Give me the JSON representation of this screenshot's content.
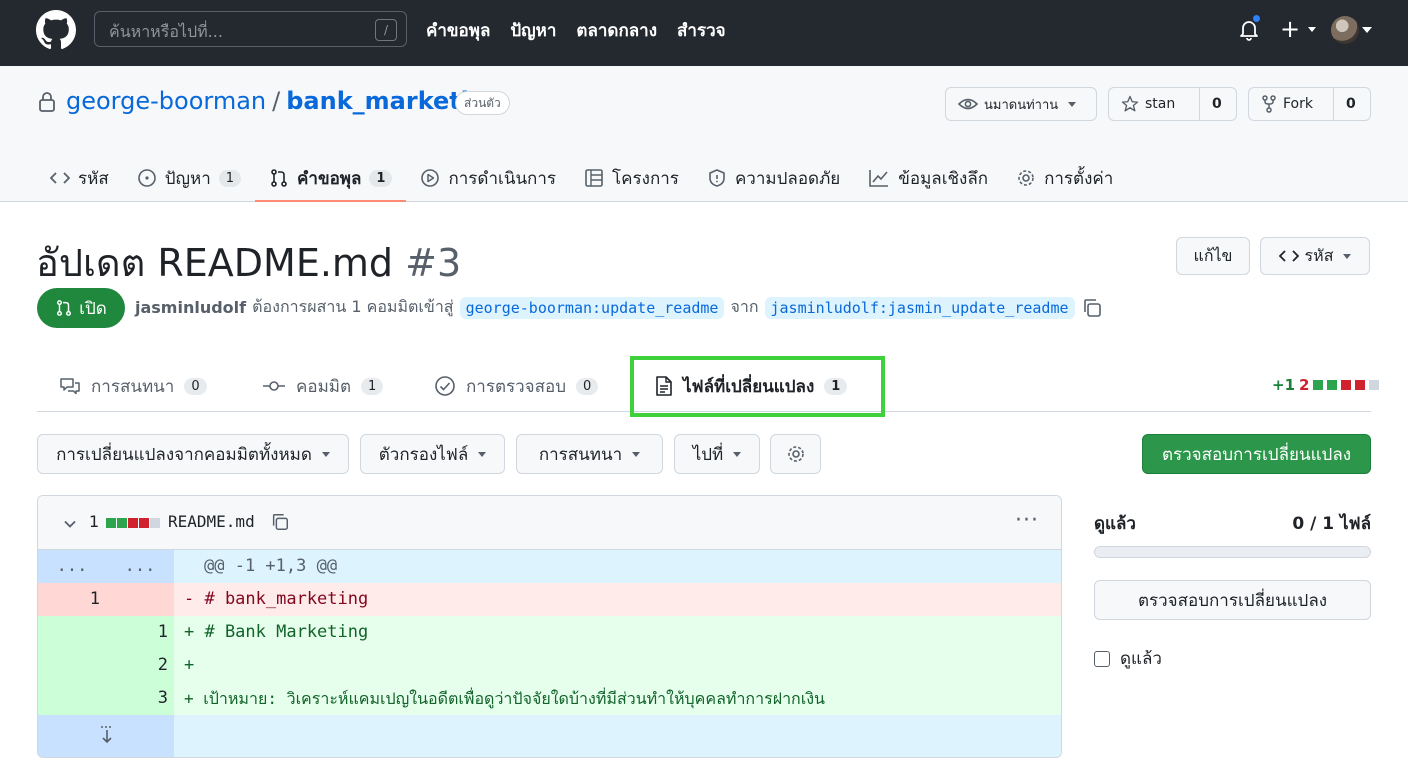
{
  "header": {
    "search_placeholder": "ค้นหาหรือไปที่...",
    "search_shortcut": "/",
    "nav": [
      "คำขอพุล",
      "ปัญหา",
      "ตลาดกลาง",
      "สำรวจ"
    ],
    "plus": "+",
    "icons": [
      "github-logo",
      "bell-icon",
      "plus-icon",
      "avatar"
    ]
  },
  "repo": {
    "owner": "george-boorman",
    "separator": "/",
    "name": "bank_marketing",
    "visibility": "ส่วนตัว",
    "watch_label": "นมาดนท่าาน",
    "star_label": "stan",
    "star_count": "0",
    "fork_label": "Fork",
    "fork_count": "0",
    "tabs": [
      {
        "label": "รหัส",
        "count": "",
        "icon": "code-icon"
      },
      {
        "label": "ปัญหา",
        "count": "1",
        "icon": "issue-icon"
      },
      {
        "label": "คำขอพุล",
        "count": "1",
        "icon": "pull-request-icon",
        "active": true
      },
      {
        "label": "การดำเนินการ",
        "count": "",
        "icon": "play-icon"
      },
      {
        "label": "โครงการ",
        "count": "",
        "icon": "table-icon"
      },
      {
        "label": "ความปลอดภัย",
        "count": "",
        "icon": "shield-icon"
      },
      {
        "label": "ข้อมูลเชิงลึก",
        "count": "",
        "icon": "graph-icon"
      },
      {
        "label": "การตั้งค่า",
        "count": "",
        "icon": "gear-icon"
      }
    ]
  },
  "pr": {
    "title": "อัปเดต README.md",
    "number": "#3",
    "edit_label": "แก้ไข",
    "code_label": "รหัส",
    "state": "เปิด",
    "author": "jasminludolf",
    "action_text": "ต้องการผสาน 1 คอมมิตเข้าสู่",
    "base_branch": "george-boorman:update_readme",
    "from_text": "จาก",
    "head_branch": "jasminludolf:jasmin_update_readme",
    "tabs": [
      {
        "label": "การสนทนา",
        "count": "0",
        "icon": "comment-icon"
      },
      {
        "label": "คอมมิต",
        "count": "1",
        "icon": "commit-icon"
      },
      {
        "label": "การตรวจสอบ",
        "count": "0",
        "icon": "check-circle-icon"
      },
      {
        "label": "ไฟล์ที่เปลี่ยนแปลง",
        "count": "1",
        "icon": "file-icon",
        "active": true
      }
    ],
    "diffstat_add": "+1",
    "diffstat_del": "2"
  },
  "toolbar": {
    "commits_filter": "การเปลี่ยนแปลงจากคอมมิตทั้งหมด",
    "file_filter": "ตัวกรองไฟล์",
    "conversations": "การสนทนา",
    "jump": "ไปที่",
    "review_button": "ตรวจสอบการเปลี่ยนแปลง"
  },
  "file": {
    "change_count": "1",
    "name": "README.md",
    "lines": [
      {
        "type": "hunk",
        "old": "...",
        "new": "...",
        "text": "@@ -1 +1,3 @@"
      },
      {
        "type": "del",
        "old": "1",
        "new": "",
        "text": "- # bank_marketing"
      },
      {
        "type": "add",
        "old": "",
        "new": "1",
        "text": "+ # Bank Marketing"
      },
      {
        "type": "add",
        "old": "",
        "new": "2",
        "text": "+"
      },
      {
        "type": "add",
        "old": "",
        "new": "3",
        "text": "+ เป้าหมาย: วิเคราะห์แคมเปญในอดีตเพื่อดูว่าปัจจัยใดบ้างที่มีส่วนทำให้บุคคลทำการฝากเงิน"
      },
      {
        "type": "expand",
        "old": "",
        "new": "",
        "text": ""
      }
    ]
  },
  "sidebar": {
    "viewed_title": "ดูแล้ว",
    "viewed_count": "0 / 1 ไฟล์",
    "viewed_progress": 0,
    "review_button": "ตรวจสอบการเปลี่ยนแปลง",
    "viewed_checkbox": "ดูแล้ว"
  },
  "colors": {
    "header_bg": "#24292f",
    "accent": "#0969da",
    "open_green": "#1f883d",
    "tab_underline": "#fd8c73",
    "highlight": "#3fd13c"
  }
}
